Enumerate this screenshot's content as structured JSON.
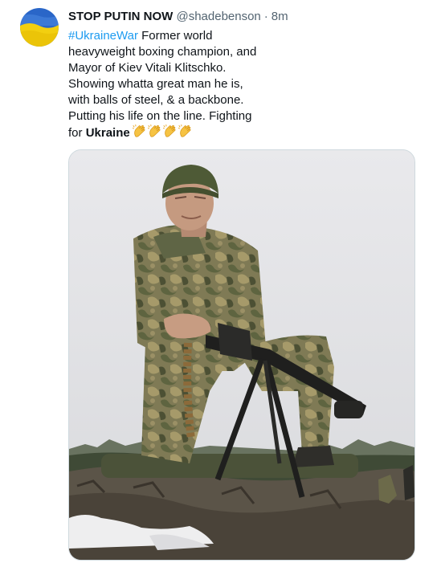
{
  "tweet": {
    "display_name": "STOP PUTIN NOW",
    "handle": "@shadebenson",
    "separator": "·",
    "time": "8m",
    "hashtag": "#UkraineWar",
    "text_main": " Former world heavyweight boxing champion, and Mayor of Kiev Vitali Klitschko. Showing whatta great man he is, with balls of steel, & a backbone. Putting his life on the line. Fighting for ",
    "text_bold": "Ukraine",
    "emoji": [
      "clapping-hands",
      "clapping-hands",
      "clapping-hands",
      "clapping-hands"
    ]
  },
  "colors": {
    "link": "#1d9bf0",
    "secondary_text": "#536471",
    "border": "#cfd9de",
    "flag_blue": "#1f5fbf",
    "flag_yellow": "#f5d000"
  }
}
